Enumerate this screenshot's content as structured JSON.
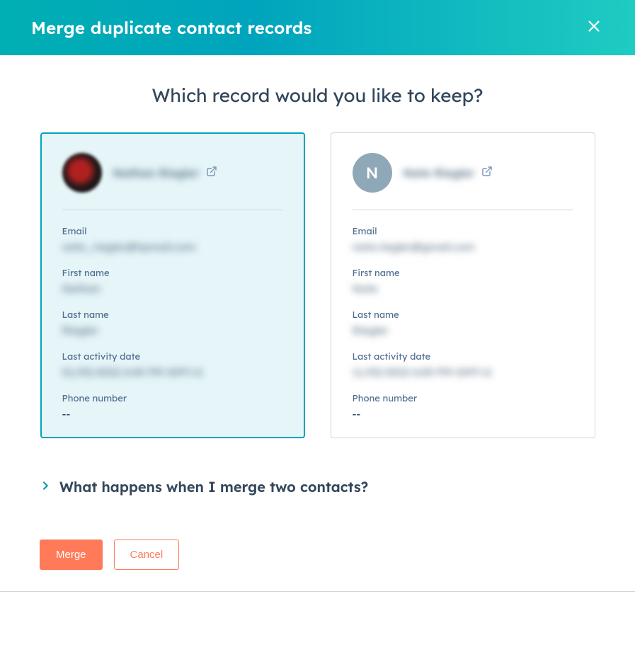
{
  "header": {
    "title": "Merge duplicate contact records"
  },
  "prompt": "Which record would you like to keep?",
  "records": [
    {
      "selected": true,
      "avatar_type": "image",
      "avatar_initial": "",
      "name": "Nathan Riegler",
      "fields": {
        "email_label": "Email",
        "email_value": "nate_riegler@hpmail.com",
        "first_label": "First name",
        "first_value": "Nathan",
        "last_label": "Last name",
        "last_value": "Riegler",
        "activity_label": "Last activity date",
        "activity_value": "01/05/2022 6:40 PM GMT+2",
        "phone_label": "Phone number",
        "phone_value": "--"
      }
    },
    {
      "selected": false,
      "avatar_type": "initial",
      "avatar_initial": "N",
      "name": "Nate Riegler",
      "fields": {
        "email_label": "Email",
        "email_value": "nate.riegler@gmail.com",
        "first_label": "First name",
        "first_value": "Nate",
        "last_label": "Last name",
        "last_value": "Riegler",
        "activity_label": "Last activity date",
        "activity_value": "11/05/2022 6:00 PM GMT+2",
        "phone_label": "Phone number",
        "phone_value": "--"
      }
    }
  ],
  "accordion": {
    "title": "What happens when I merge two contacts?"
  },
  "footer": {
    "merge_label": "Merge",
    "cancel_label": "Cancel"
  }
}
